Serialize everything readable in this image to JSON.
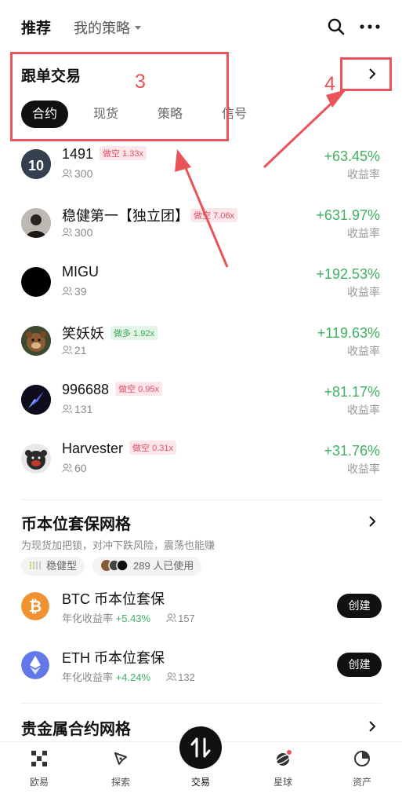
{
  "topnav": {
    "recommend": "推荐",
    "my_strategies": "我的策略"
  },
  "copy_trading": {
    "title": "跟单交易",
    "tabs": [
      "合约",
      "现货",
      "策略",
      "信号"
    ],
    "active_tab": "合约",
    "return_label": "收益率",
    "traders": [
      {
        "name": "1491",
        "tag": "做空 1.33x",
        "tag_type": "short",
        "followers": "300",
        "return": "+63.45%"
      },
      {
        "name": "稳健第一【独立团】",
        "tag": "做空 7.06x",
        "tag_type": "short",
        "followers": "300",
        "return": "+631.97%"
      },
      {
        "name": "MIGU",
        "tag": "",
        "tag_type": "",
        "followers": "39",
        "return": "+192.53%"
      },
      {
        "name": "笑妖妖",
        "tag": "做多 1.92x",
        "tag_type": "long",
        "followers": "21",
        "return": "+119.63%"
      },
      {
        "name": "996688",
        "tag": "做空 0.95x",
        "tag_type": "short",
        "followers": "131",
        "return": "+81.17%"
      },
      {
        "name": "Harvester",
        "tag": "做空 0.31x",
        "tag_type": "short",
        "followers": "60",
        "return": "+31.76%"
      }
    ]
  },
  "annotations": {
    "box3": "3",
    "box4": "4",
    "color": "#e8545a"
  },
  "grid_section": {
    "title": "币本位套保网格",
    "description": "为现货加把锁，对冲下跌风险，震荡也能赚",
    "risk_chip": "稳健型",
    "users_chip": "289 人已使用",
    "annual_label": "年化收益率",
    "create_label": "创建",
    "items": [
      {
        "name": "BTC 币本位套保",
        "annual": "+5.43%",
        "users": "157",
        "coin": "btc-coin-icon",
        "color": "#f0922f"
      },
      {
        "name": "ETH 币本位套保",
        "annual": "+4.24%",
        "users": "132",
        "coin": "eth-coin-icon",
        "color": "#6277e8"
      }
    ]
  },
  "metal_section": {
    "title": "贵金属合约网格"
  },
  "bottom_nav": {
    "items": [
      "欧易",
      "探索",
      "交易",
      "星球",
      "资产"
    ],
    "active": "交易"
  },
  "colors": {
    "positive": "#3fb161",
    "short_tag": "#e0506a",
    "long_tag": "#3fa85a"
  }
}
